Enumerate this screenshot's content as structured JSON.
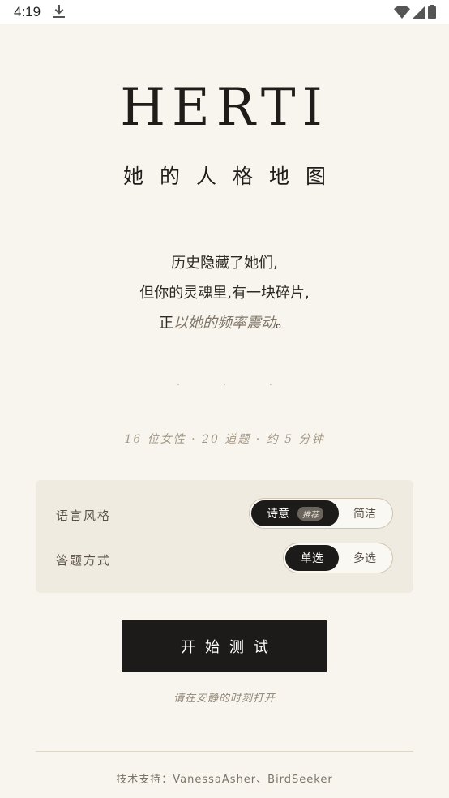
{
  "status_bar": {
    "time": "4:19",
    "download_icon": "download-icon",
    "wifi_icon": "wifi-icon",
    "signal_icon": "signal-icon",
    "battery_icon": "battery-icon"
  },
  "header": {
    "logo": "HERTI",
    "subtitle": "她的人格地图"
  },
  "intro": {
    "line1": "历史隐藏了她们,",
    "line2": "但你的灵魂里,有一块碎片,",
    "line3_prefix": "正",
    "line3_em": "以她的频率震动",
    "line3_suffix": "。"
  },
  "divider_dots": "· · ·",
  "meta": "16 位女性 · 20 道题 · 约 5 分钟",
  "settings": {
    "language_style": {
      "label": "语言风格",
      "options": [
        "诗意",
        "简洁"
      ],
      "selected": "诗意",
      "badge": "推荐"
    },
    "answer_mode": {
      "label": "答题方式",
      "options": [
        "单选",
        "多选"
      ],
      "selected": "单选"
    }
  },
  "start_button": "开始测试",
  "hint": "请在安静的时刻打开",
  "credits": "技术支持：VanessaAsher、BirdSeeker",
  "colors": {
    "background": "#f8f5ee",
    "panel": "#f0ebe0",
    "primary": "#1d1b19",
    "muted": "#a29786"
  }
}
